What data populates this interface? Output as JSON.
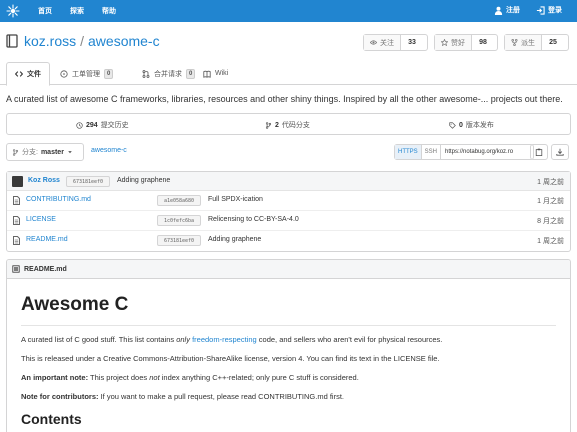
{
  "nav": {
    "home": "首页",
    "explore": "探索",
    "help": "帮助",
    "register": "注册",
    "login": "登录"
  },
  "repo": {
    "owner": "koz.ross",
    "separator": "/",
    "name": "awesome-c",
    "watch_label": "关注",
    "watch_count": "33",
    "star_label": "赞好",
    "star_count": "98",
    "fork_label": "派生",
    "fork_count": "25"
  },
  "tabs": [
    {
      "label": "文件",
      "badge": ""
    },
    {
      "label": "工单管理",
      "badge": "0"
    },
    {
      "label": "合并请求",
      "badge": "0"
    },
    {
      "label": "Wiki",
      "badge": ""
    }
  ],
  "description": "A curated list of awesome C frameworks, libraries, resources and other shiny things. Inspired by all the other awesome-... projects out there.",
  "stats": {
    "commits_count": "294",
    "commits_label": "提交历史",
    "branches_count": "2",
    "branches_label": "代码分支",
    "releases_count": "0",
    "releases_label": "版本发布"
  },
  "branch": {
    "label": "分支:",
    "value": "master",
    "path": "awesome-c",
    "https": "HTTPS",
    "ssh": "SSH",
    "clone_url": "https://notabug.org/koz.ro"
  },
  "last_commit": {
    "author": "Koz Ross",
    "sha": "673181eef0",
    "message": "Adding graphene",
    "time": "1 周之前"
  },
  "files": [
    {
      "name": "CONTRIBUTING.md",
      "sha": "a1e058a680",
      "message": "Full SPDX-ication",
      "time": "1 月之前"
    },
    {
      "name": "LICENSE",
      "sha": "1c0fefc6ba",
      "message": "Relicensing to CC-BY-SA-4.0",
      "time": "8 月之前"
    },
    {
      "name": "README.md",
      "sha": "673181eef0",
      "message": "Adding graphene",
      "time": "1 周之前"
    }
  ],
  "readme": {
    "filename": "README.md",
    "title": "Awesome C",
    "p1_a": "A curated list of C good stuff. This list contains ",
    "p1_em": "only",
    "p1_link": "freedom-respecting",
    "p1_b": " code, and sellers who aren't evil for physical resources.",
    "p2": "This is released under a Creative Commons-Attribution-ShareAlike license, version 4. You can find its text in the LICENSE file.",
    "p3_strong": "An important note:",
    "p3_a": " This project does ",
    "p3_em": "not",
    "p3_b": " index anything C++-related; only pure C stuff is considered.",
    "p4_strong": "Note for contributors:",
    "p4_rest": " If you want to make a pull request, please read CONTRIBUTING.md first.",
    "contents": "Contents"
  }
}
